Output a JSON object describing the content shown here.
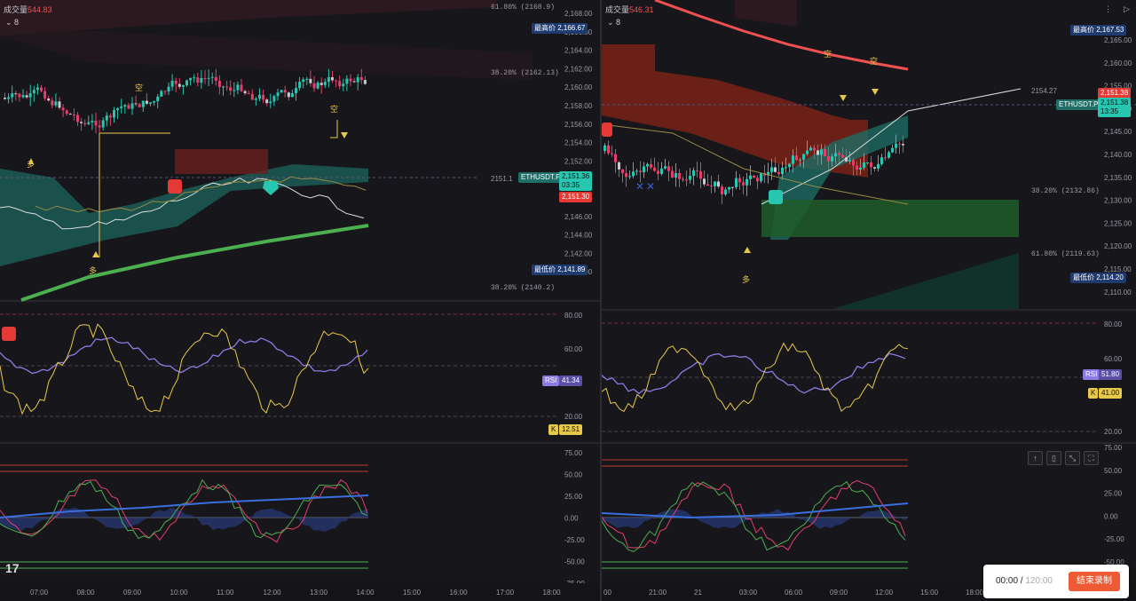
{
  "left": {
    "volume_label": "成交量",
    "volume_value": "544.83",
    "collapse": "8",
    "price_axis": [
      "2,168.00",
      "2,166.00",
      "2,164.00",
      "2,162.00",
      "2,160.00",
      "2,158.00",
      "2,156.00",
      "2,154.00",
      "2,152.00",
      "2,150.00",
      "2,148.00",
      "2,146.00",
      "2,144.00",
      "2,142.00",
      "2,140.00"
    ],
    "high_label": "最高价",
    "high_value": "2,166.67",
    "low_label": "最低价",
    "low_value": "2,141.89",
    "symbol": "ETHUSDT.P",
    "symbol_price": "2,151.36",
    "symbol_countdown": "03:35",
    "red_price": "2,151.30",
    "fib_618": "61.80%  (2168.9)",
    "fib_382_top": "38.20%  (2162.13)",
    "fib_382_bottom": "38.20%  (2140.2)",
    "current_line_value": "2151.1",
    "marks": {
      "short": "空",
      "long": "多"
    },
    "rsi_axis": [
      "80.00",
      "60.00",
      "20.00"
    ],
    "rsi_label": "RSI",
    "rsi_value": "41.34",
    "k_label": "K",
    "k_value": "12.51",
    "osc_axis": [
      "75.00",
      "50.00",
      "25.00",
      "0.00",
      "-25.00",
      "-50.00",
      "-75.00"
    ],
    "time_axis": [
      "07:00",
      "08:00",
      "09:00",
      "10:00",
      "11:00",
      "12:00",
      "13:00",
      "14:00",
      "15:00",
      "16:00",
      "17:00",
      "18:00"
    ],
    "logo": "17"
  },
  "right": {
    "volume_label": "成交量",
    "volume_value": "546.31",
    "collapse": "8",
    "price_axis": [
      "2,165.00",
      "2,160.00",
      "2,155.00",
      "2,150.00",
      "2,145.00",
      "2,140.00",
      "2,135.00",
      "2,130.00",
      "2,125.00",
      "2,120.00",
      "2,115.00",
      "2,110.00"
    ],
    "high_label": "最高价",
    "high_value": "2,167.53",
    "low_label": "最低价",
    "low_value": "2,114.20",
    "symbol": "ETHUSDT.P",
    "red_price": "2,151.38",
    "symbol_price": "2,151.38",
    "symbol_countdown": "13:35",
    "level_2154": "2154.27",
    "fib_382": "38.20%  (2132.86)",
    "fib_618": "61.80%  (2119.63)",
    "marks": {
      "short": "空",
      "long": "多"
    },
    "rsi_axis": [
      "80.00",
      "60.00",
      "20.00"
    ],
    "rsi_label": "RSI",
    "rsi_value": "51.80",
    "k_label": "K",
    "k_value": "41.00",
    "osc_axis": [
      "75.00",
      "50.00",
      "25.00",
      "0.00",
      "-25.00",
      "-50.00"
    ],
    "time_axis": [
      "00",
      "21:00",
      "21",
      "03:00",
      "06:00",
      "09:00",
      "12:00",
      "15:00",
      "18:00"
    ]
  },
  "recorder": {
    "elapsed": "00:00",
    "separator": " / ",
    "total": "120:00",
    "stop_label": "结束录制"
  },
  "colors": {
    "up": "#26c6b0",
    "down": "#e53e6a",
    "ma_red": "#f05050",
    "ma_green": "#4caf50",
    "rsi_purple": "#8c7ae6",
    "k_yellow": "#e8c84a",
    "tag_blue": "#1f3a6e"
  }
}
